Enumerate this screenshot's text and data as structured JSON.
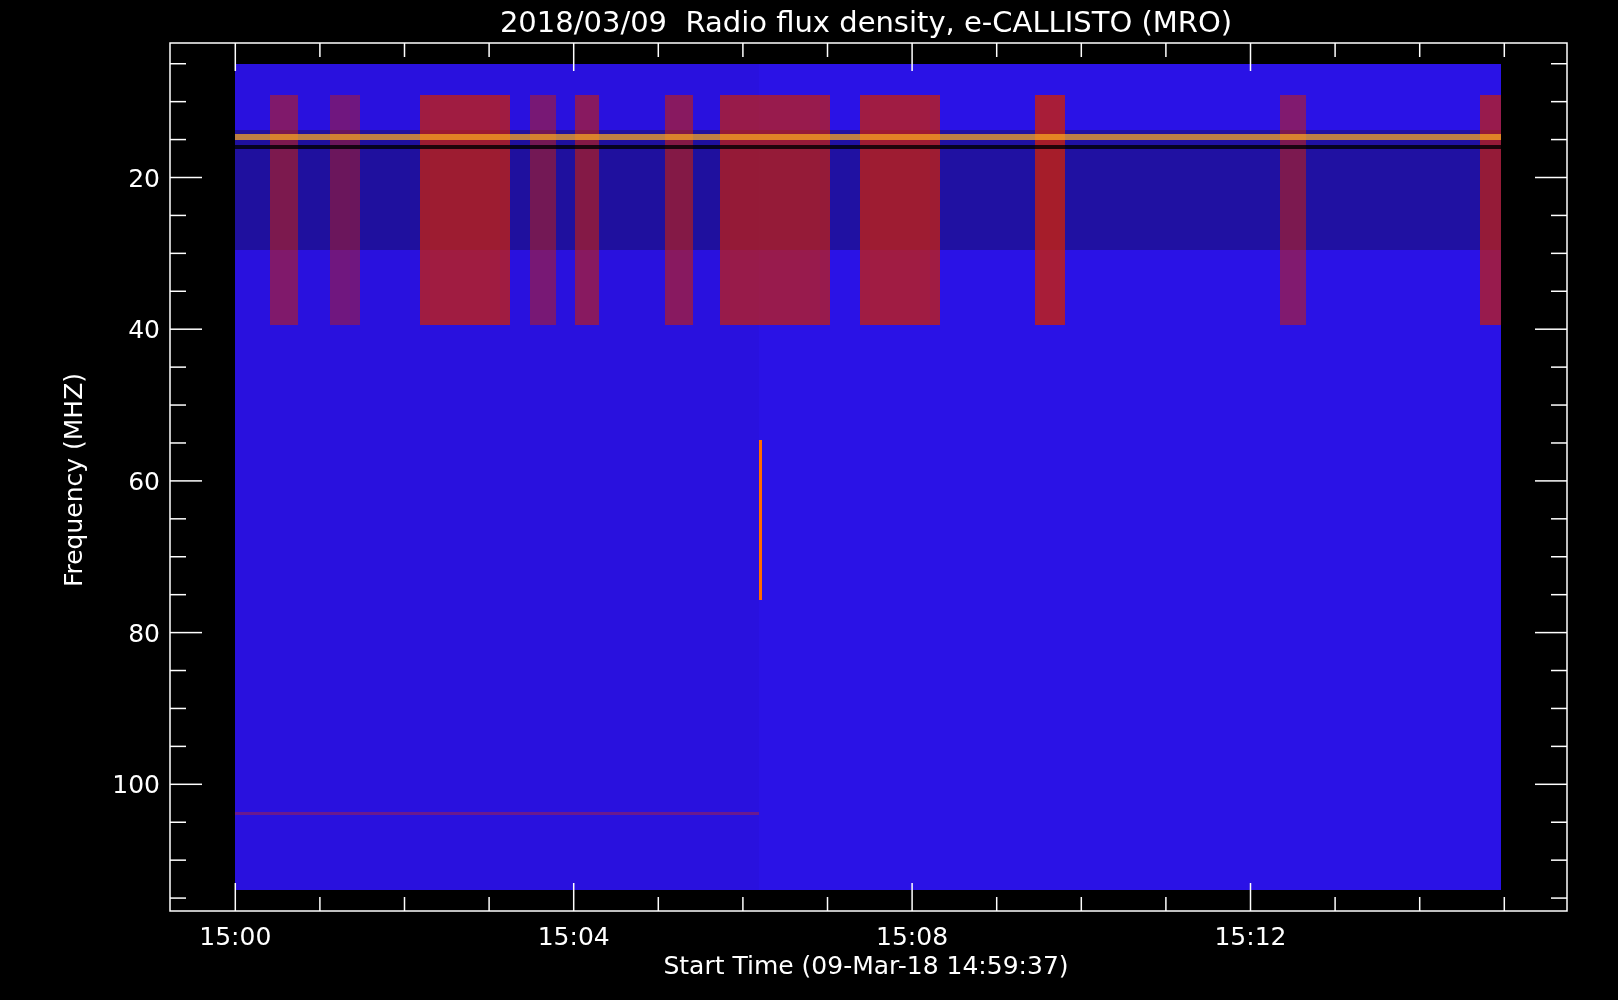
{
  "plot": {
    "title": "2018/03/09  Radio flux density, e-CALLISTO (MRO)",
    "y_axis": {
      "label": "Frequency (MHZ)",
      "ticks": [
        "20",
        "40",
        "60",
        "80",
        "100"
      ]
    },
    "x_axis": {
      "label": "Start Time (09-Mar-18 14:59:37)",
      "ticks": [
        "15:00",
        "15:04",
        "15:08",
        "15:12"
      ]
    }
  }
}
